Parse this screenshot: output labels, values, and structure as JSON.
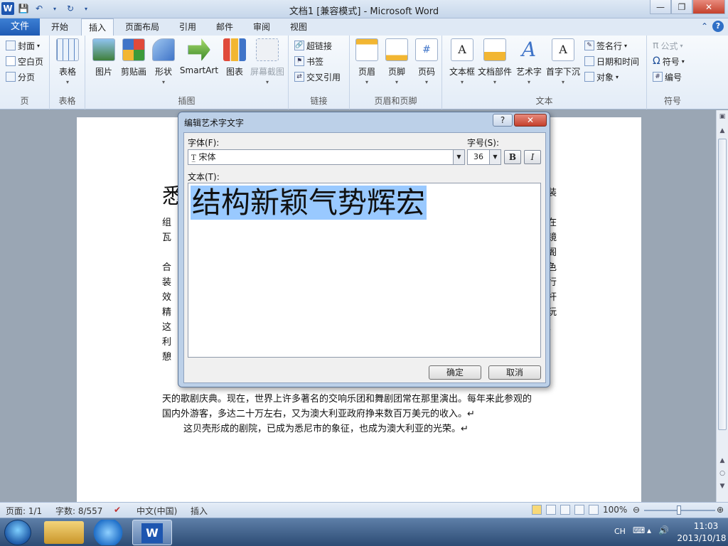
{
  "window": {
    "title": "文档1 [兼容模式] - Microsoft Word",
    "logo": "W"
  },
  "qat": {
    "save_icon": "save-icon",
    "undo_icon": "undo-icon",
    "redo_icon": "redo-icon"
  },
  "tabs": {
    "file": "文件",
    "items": [
      "开始",
      "插入",
      "页面布局",
      "引用",
      "邮件",
      "审阅",
      "视图"
    ],
    "active": "插入"
  },
  "ribbon": {
    "pages": {
      "label": "页",
      "cover": "封面",
      "blank": "空白页",
      "break": "分页"
    },
    "tables": {
      "label": "表格",
      "table": "表格"
    },
    "illustrations": {
      "label": "插图",
      "picture": "图片",
      "clipart": "剪贴画",
      "shapes": "形状",
      "smartart": "SmartArt",
      "chart": "图表",
      "screenshot": "屏幕截图"
    },
    "links": {
      "label": "链接",
      "hyperlink": "超链接",
      "bookmark": "书签",
      "crossref": "交叉引用"
    },
    "headerfooter": {
      "label": "页眉和页脚",
      "header": "页眉",
      "footer": "页脚",
      "pagenum": "页码"
    },
    "text": {
      "label": "文本",
      "textbox": "文本框",
      "quickparts": "文档部件",
      "wordart": "艺术字",
      "dropcap": "首字下沉",
      "signature": "签名行",
      "datetime": "日期和时间",
      "object": "对象"
    },
    "symbols": {
      "label": "符号",
      "equation": "公式",
      "symbol": "符号",
      "number": "编号"
    }
  },
  "document": {
    "heading_glyph": "悉",
    "left_fragments": [
      "组",
      "瓦",
      "合",
      "装",
      "效",
      "精",
      "这",
      "利",
      "憩"
    ],
    "right_fragments": [
      "装",
      "在",
      "镜",
      "阁",
      "色",
      "行",
      "杆",
      "玩",
      "、"
    ],
    "lines": [
      "天的歌剧庆典。现在，世界上许多著名的交响乐团和舞剧团常在那里演出。每年来此参观的",
      "国内外游客，多达二十万左右，又为澳大利亚政府挣来数百万美元的收入。↵",
      "这贝壳形成的剧院，已成为悉尼市的象征，也成为澳大利亚的光荣。↵"
    ]
  },
  "dialog": {
    "title": "编辑艺术字文字",
    "font_label": "字体(F):",
    "font_value": "宋体",
    "size_label": "字号(S):",
    "size_value": "36",
    "bold": "B",
    "italic": "I",
    "text_label": "文本(T):",
    "text_value": "结构新颖气势辉宏",
    "ok": "确定",
    "cancel": "取消",
    "help": "?"
  },
  "status": {
    "page": "页面: 1/1",
    "words": "字数: 8/557",
    "lang": "中文(中国)",
    "mode": "插入",
    "zoom": "100%"
  },
  "taskbar": {
    "ime": "CH",
    "time": "11:03",
    "date": "2013/10/18"
  }
}
